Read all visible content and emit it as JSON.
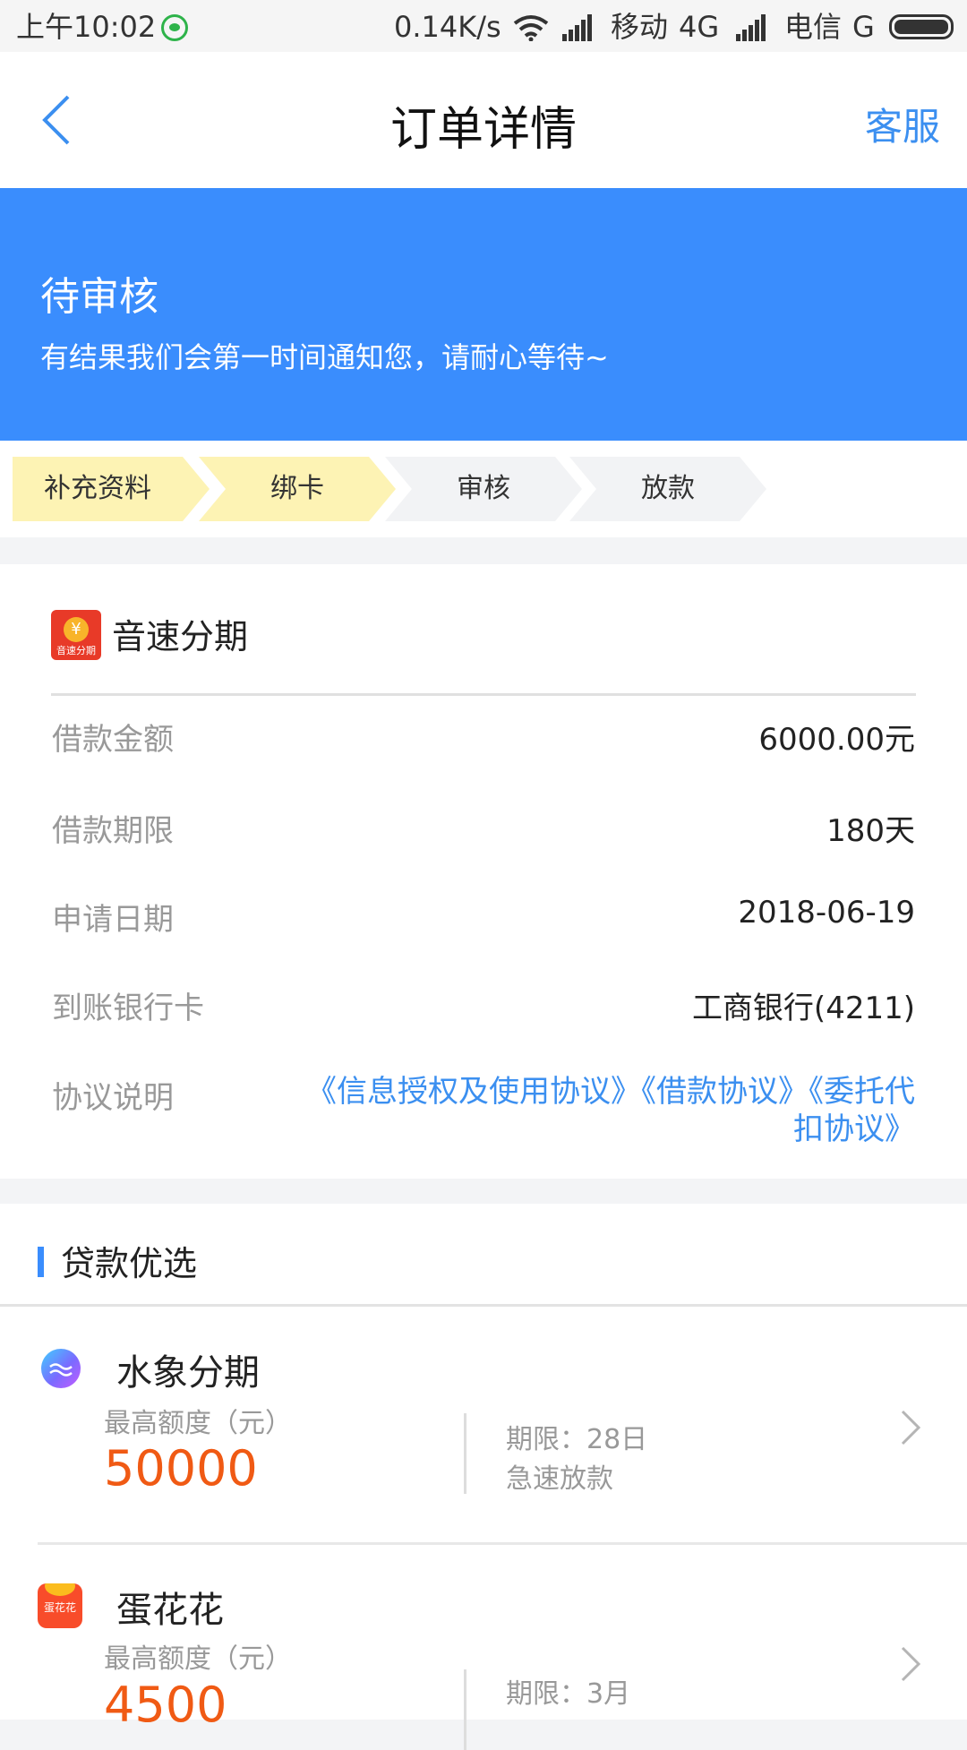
{
  "status_bar": {
    "time": "上午10:02",
    "speed": "0.14K/s",
    "carrier1": "移动",
    "network1": "4G",
    "carrier2": "电信",
    "network2": "G"
  },
  "header": {
    "title": "订单详情",
    "service_label": "客服"
  },
  "banner": {
    "title": "待审核",
    "subtitle": "有结果我们会第一时间通知您，请耐心等待~",
    "color": "#3a8dfd"
  },
  "steps": [
    {
      "label": "补充资料",
      "state": "done"
    },
    {
      "label": "绑卡",
      "state": "done"
    },
    {
      "label": "审核",
      "state": "pending"
    },
    {
      "label": "放款",
      "state": "pending"
    }
  ],
  "order": {
    "app_name": "音速分期",
    "logo_text": "音速分期",
    "logo_symbol": "¥",
    "rows": [
      {
        "label": "借款金额",
        "value": "6000.00元"
      },
      {
        "label": "借款期限",
        "value": "180天"
      },
      {
        "label": "申请日期",
        "value": "2018-06-19"
      },
      {
        "label": "到账银行卡",
        "value": "工商银行(4211)"
      }
    ],
    "agreement_label": "协议说明",
    "agreement_links": "《信息授权及使用协议》《借款协议》《委托代扣协议》"
  },
  "loans": {
    "section_title": "贷款优选",
    "items": [
      {
        "name": "水象分期",
        "amount_label": "最高额度（元）",
        "amount": "50000",
        "term": "期限：28日",
        "feature": "急速放款",
        "logo_icon": "water-logo-icon"
      },
      {
        "name": "蛋花花",
        "amount_label": "最高额度（元）",
        "amount": "4500",
        "term": "期限：3月",
        "feature": "",
        "logo_text": "蛋花花",
        "logo_icon": "egg-logo-icon"
      }
    ]
  },
  "colors": {
    "accent": "#3b8ff0",
    "amount": "#f05a14",
    "step_done": "#fdf3b4",
    "step_pending": "#f2f3f5"
  }
}
